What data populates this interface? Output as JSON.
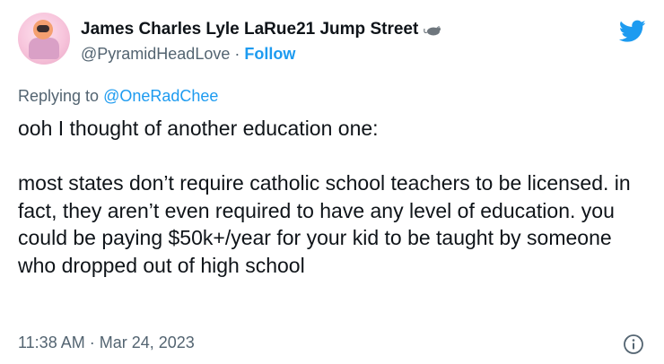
{
  "author": {
    "display_name": "James Charles Lyle LaRue21 Jump Street",
    "handle": "@PyramidHeadLove",
    "separator": "·",
    "follow_label": "Follow",
    "emoji_icon": "rat-icon"
  },
  "platform_icon": "twitter-bird-icon",
  "reply": {
    "prefix": "Replying to",
    "mention": "@OneRadChee"
  },
  "body": {
    "line1": "ooh I thought of another education one:",
    "paragraph2": "most states don’t require catholic school teachers to be licensed. in fact, they aren’t even required to have any level of education. you could be paying $50k+/year for your kid to be taught by someone who dropped out of high school"
  },
  "meta": {
    "time": "11:38 AM",
    "separator": "·",
    "date": "Mar 24, 2023"
  },
  "colors": {
    "accent": "#1d9bf0",
    "secondary_text": "#536471",
    "primary_text": "#0f1419"
  }
}
